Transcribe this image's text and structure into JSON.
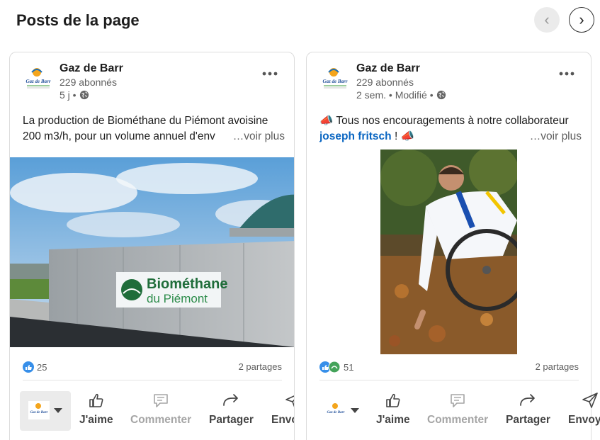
{
  "header": {
    "title": "Posts de la page",
    "prev_icon": "chevron-left-icon",
    "next_icon": "chevron-right-icon"
  },
  "posts": [
    {
      "author": "Gaz de Barr",
      "followers": "229 abonnés",
      "time": "5 j •",
      "text_line1": "La production de Biométhane du Piémont avoisine",
      "text_line2": "200 m3/h, pour un volume annuel d'env",
      "see_more": "…voir plus",
      "image_caption_line1": "Biométhane",
      "image_caption_line2": "du Piémont",
      "reaction_count": "25",
      "shares": "2 partages"
    },
    {
      "author": "Gaz de Barr",
      "followers": "229 abonnés",
      "time": "2 sem. • Modifié •",
      "text_line1": "📣 Tous nos encouragements à notre collaborateur",
      "mention": "joseph fritsch",
      "text_after_mention": " ! 📣",
      "see_more": "…voir plus",
      "reaction_count": "51",
      "shares": "2 partages"
    }
  ],
  "actions": {
    "like": "J'aime",
    "comment": "Commenter",
    "share": "Partager",
    "send": "Envoyer"
  },
  "logo_text": "Gaz de Barr",
  "colors": {
    "link": "#0a66c2",
    "like_blue": "#378fe9",
    "muted": "#5f5f5f"
  }
}
